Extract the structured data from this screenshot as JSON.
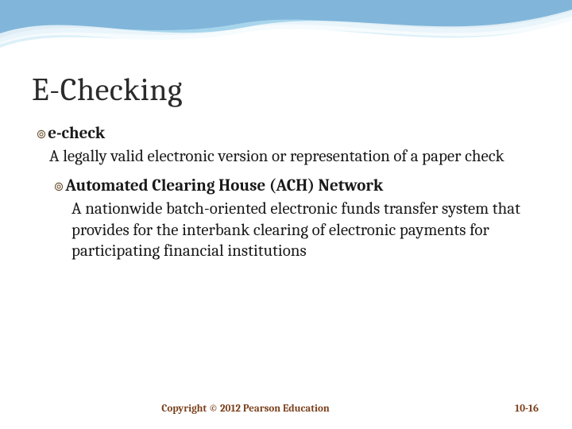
{
  "title": "E-Checking",
  "bullet_glyph": "➢",
  "items": [
    {
      "term": "e-check",
      "definition": "A legally valid electronic version or representation of a paper check"
    },
    {
      "term": "Automated Clearing House (ACH) Network",
      "definition": "A nationwide batch-oriented electronic funds transfer system that provides for the interbank clearing of electronic payments for participating financial institutions"
    }
  ],
  "footer": {
    "copyright": "Copyright © 2012 Pearson Education",
    "page": "10-16"
  },
  "theme": {
    "accent_wave_colors": [
      "#0b3d91",
      "#4da3d6",
      "#bfe3f2"
    ],
    "title_color": "#2b2b2b",
    "footer_color": "#7a3f1a"
  }
}
